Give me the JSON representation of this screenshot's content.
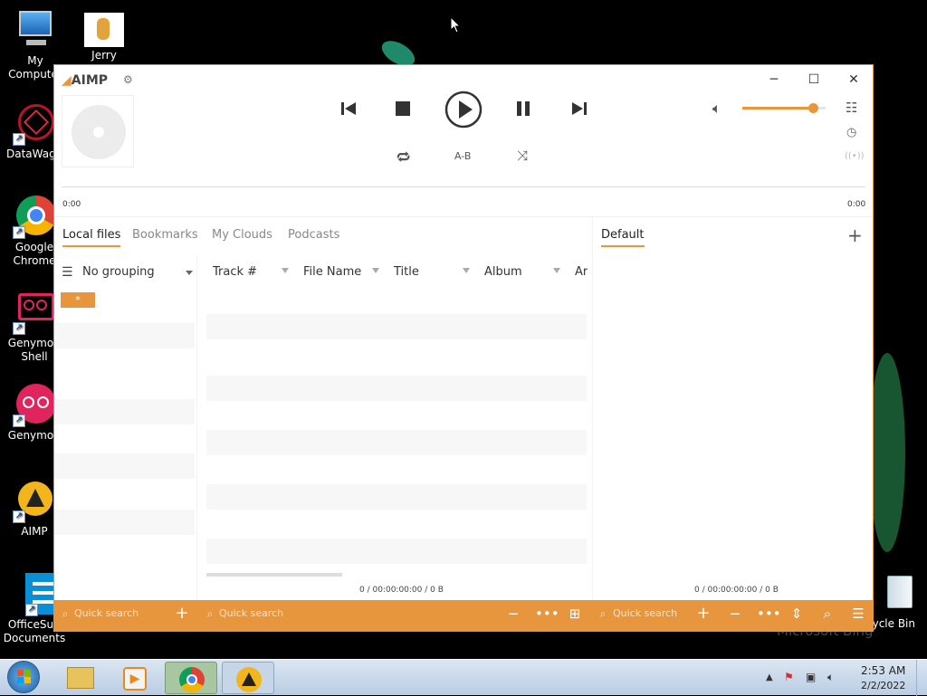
{
  "desktop": {
    "icons": [
      {
        "label": "My Computer",
        "icon": "computer-icon"
      },
      {
        "label": "Jerry",
        "icon": "jerry-icon"
      },
      {
        "label": "DataWago",
        "icon": "datawago-icon"
      },
      {
        "label": "Google Chrome",
        "icon": "chrome-icon"
      },
      {
        "label": "Genymoti Shell",
        "icon": "genymotion-shell-icon"
      },
      {
        "label": "Genymoti",
        "icon": "genymotion-icon"
      },
      {
        "label": "AIMP",
        "icon": "aimp-icon"
      },
      {
        "label": "OfficeSuit Documents",
        "icon": "officesuite-icon"
      },
      {
        "label": "cycle Bin",
        "icon": "recycle-bin-icon"
      }
    ],
    "watermark": "Microsoft Bing"
  },
  "aimp": {
    "logo": "AIMP",
    "time_start": "0:00",
    "time_end": "0:00",
    "controls": {
      "ab_label": "A-B"
    },
    "volume_percent": 85,
    "tabs": [
      {
        "label": "Local files",
        "active": true
      },
      {
        "label": "Bookmarks",
        "active": false
      },
      {
        "label": "My Clouds",
        "active": false
      },
      {
        "label": "Podcasts",
        "active": false
      }
    ],
    "playlist_tab": "Default",
    "grouping": "No grouping",
    "group_item": "*",
    "columns": [
      "Track #",
      "File Name",
      "Title",
      "Album",
      "Ar"
    ],
    "status_left": "0 / 00:00:00:00 / 0 B",
    "status_right": "0 / 00:00:00:00 / 0 B",
    "quick_search_1": "Quick search",
    "quick_search_2": "Quick search",
    "quick_search_3": "Quick search"
  },
  "taskbar": {
    "time": "2:53 AM",
    "date": "2/2/2022"
  },
  "colors": {
    "accent": "#e8963e",
    "taskbar": "#c5d6ea"
  }
}
